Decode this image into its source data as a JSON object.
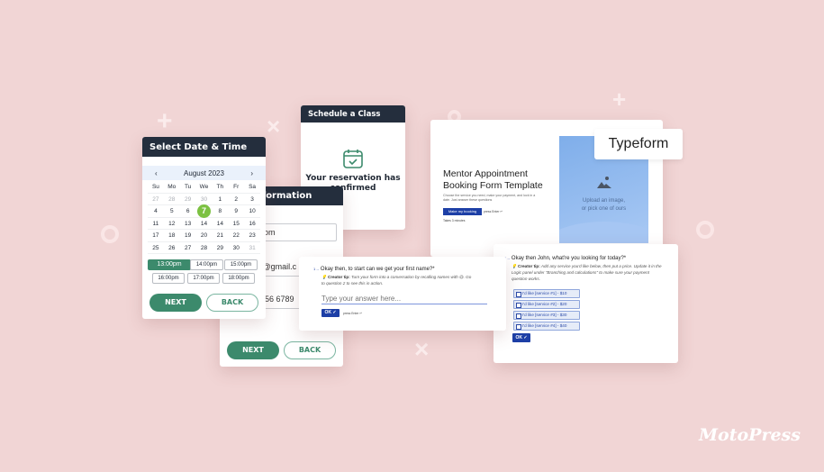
{
  "calendar_card": {
    "title": "Select Date & Time",
    "month": "August 2023",
    "prev_icon": "‹",
    "next_icon": "›",
    "weekdays": [
      "Su",
      "Mo",
      "Tu",
      "We",
      "Th",
      "Fr",
      "Sa"
    ],
    "weeks": [
      [
        "27",
        "28",
        "29",
        "30",
        "1",
        "2",
        "3"
      ],
      [
        "4",
        "5",
        "6",
        "7",
        "8",
        "9",
        "10"
      ],
      [
        "11",
        "12",
        "13",
        "14",
        "14",
        "15",
        "16"
      ],
      [
        "17",
        "18",
        "19",
        "20",
        "21",
        "22",
        "23"
      ],
      [
        "25",
        "26",
        "27",
        "28",
        "29",
        "30",
        "31"
      ]
    ],
    "selected_day": "7",
    "times": [
      "13:00pm",
      "14:00pm",
      "15:00pm",
      "16:00pm",
      "17:00pm",
      "18:00pm"
    ],
    "selected_time": "13:00pm",
    "next_label": "NEXT",
    "back_label": "BACK",
    "accent": "#3c8a6c",
    "selected_color": "#7cc142"
  },
  "info_card": {
    "title": "Information",
    "name_value": "om",
    "email_value": "y@gmail.c",
    "phone_value": "56 6789",
    "next_label": "NEXT",
    "back_label": "BACK"
  },
  "schedule_card": {
    "title": "Schedule a Class",
    "icon": "calendar-check-icon",
    "line1": "Your reservation has",
    "line2": "confirmed"
  },
  "typeform_card": {
    "badge": "Typeform",
    "title_line1": "Mentor Appointment",
    "title_line2": "Booking Form Template",
    "description_line1": "Choose the service you need, make your payment, and lock in a",
    "description_line2": "date. Just answer these questions",
    "button": "Make my booking",
    "press_enter": "press Enter ↵",
    "takes": "Takes 3 minutes",
    "image_line1": "Upload an image,",
    "image_line2": "or pick one of ours"
  },
  "question1": {
    "number": "1→",
    "question": "Okay then, to start can we get your first name?*",
    "tip_label": "Creator tip:",
    "tip_line1": "Turn your form into a conversation by recalling names with @. Go",
    "tip_line2": "to question 2 to see this in action.",
    "placeholder": "Type your answer here...",
    "ok": "OK ✓",
    "press_enter": "press Enter ↵"
  },
  "question2": {
    "number": "1→",
    "question": "Okay then John, what're you looking for today?*",
    "tip_label": "Creator tip:",
    "tip_line1": "Add any service you'd like below, then put a price. Update it in the",
    "tip_line2": "Logic panel under \"Branching and calculations\" to make sure your payment",
    "tip_line3": "question works.",
    "options": [
      "I'd like [service #1] - $10",
      "I'd like [service #2] - $20",
      "I'd like [service #3] - $30",
      "I'd like [service #4] - $40"
    ],
    "ok": "OK ✓"
  },
  "logo": "MotoPress"
}
